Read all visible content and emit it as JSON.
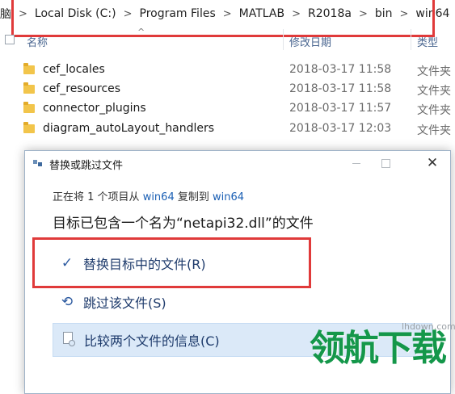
{
  "explorer": {
    "breadcrumb": [
      "脑",
      "Local Disk (C:)",
      "Program Files",
      "MATLAB",
      "R2018a",
      "bin",
      "win64"
    ],
    "separator": ">",
    "columns": {
      "name": "名称",
      "date": "修改日期",
      "type": "类型"
    },
    "rows": [
      {
        "name": "cef_locales",
        "date": "2018-03-17 11:58",
        "type": "文件夹"
      },
      {
        "name": "cef_resources",
        "date": "2018-03-17 11:58",
        "type": "文件夹"
      },
      {
        "name": "connector_plugins",
        "date": "2018-03-17 11:57",
        "type": "文件夹"
      },
      {
        "name": "diagram_autoLayout_handlers",
        "date": "2018-03-17 12:03",
        "type": "文件夹"
      }
    ],
    "accent_color": "#e03a3a"
  },
  "dialog": {
    "title": "替换或跳过文件",
    "progress": {
      "prefix": "正在将 1 个项目从",
      "source": "win64",
      "middle": "复制到",
      "destination": "win64"
    },
    "headline": "目标已包含一个名为“netapi32.dll”的文件",
    "options": [
      {
        "icon": "checkmark-icon",
        "label": "替换目标中的文件(R)"
      },
      {
        "icon": "skip-arrow-icon",
        "label": "跳过该文件(S)"
      },
      {
        "icon": "compare-doc-icon",
        "label": "比较两个文件的信息(C)"
      }
    ],
    "window_controls": {
      "close": "✕"
    }
  },
  "watermark": {
    "url": "lhdown.com",
    "text": "领航下载"
  }
}
